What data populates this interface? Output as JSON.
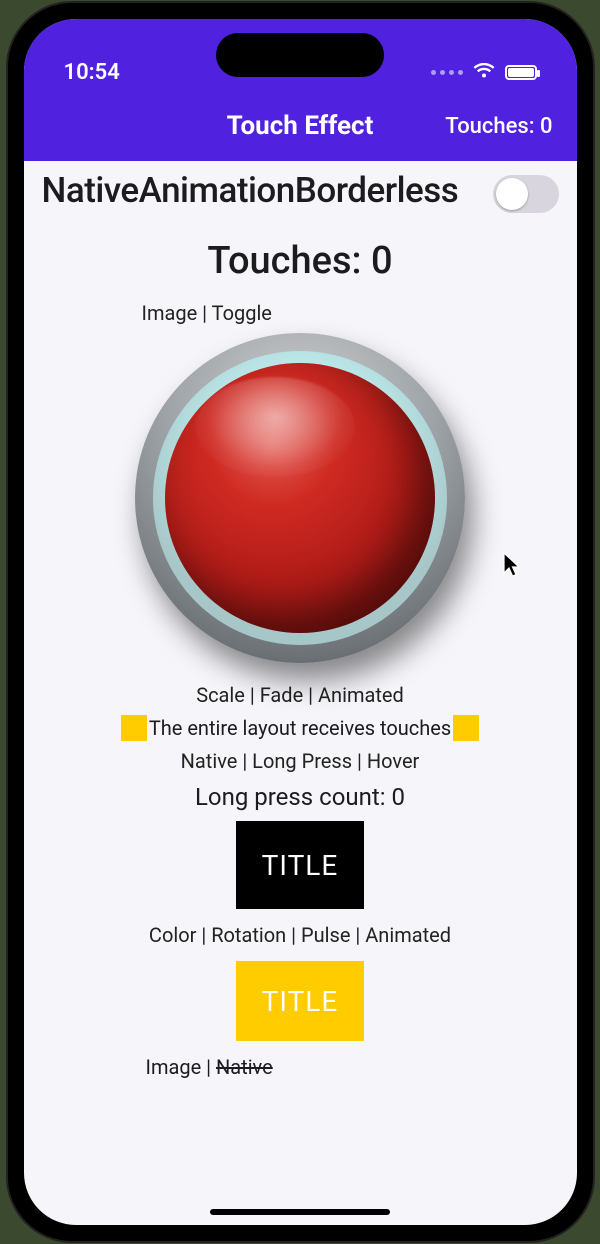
{
  "status": {
    "time": "10:54"
  },
  "appbar": {
    "title": "Touch Effect",
    "touches_label": "Touches: 0"
  },
  "setting": {
    "label": "NativeAnimationBorderless",
    "enabled": false
  },
  "content": {
    "touches_big": "Touches: 0",
    "section_image_toggle": "Image | Toggle",
    "section_scale_fade": "Scale | Fade | Animated",
    "layout_touches_text": "The entire layout receives touches",
    "section_native_longpress": "Native | Long Press | Hover",
    "long_press_count": "Long press count: 0",
    "tile_title_1": "TITLE",
    "section_color_rotation": "Color | Rotation | Pulse | Animated",
    "tile_title_2": "TITLE",
    "section_image_native_prefix": "Image | ",
    "section_image_native_strike": "Native"
  }
}
